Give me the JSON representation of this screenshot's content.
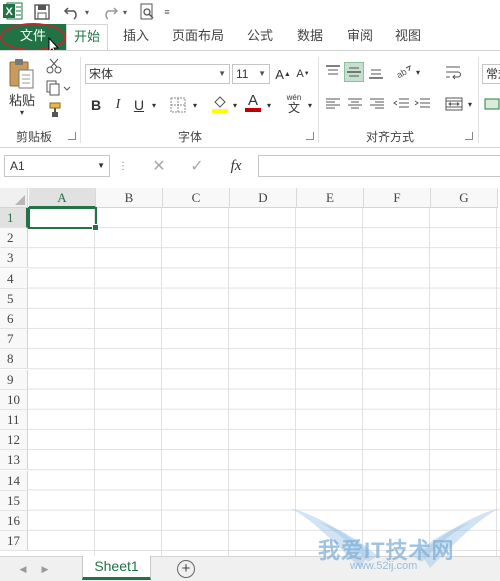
{
  "tabs": [
    "文件",
    "开始",
    "插入",
    "页面布局",
    "公式",
    "数据",
    "审阅",
    "视图"
  ],
  "ribbon": {
    "paste_label": "粘贴",
    "clipboard_label": "剪贴板",
    "font_label": "字体",
    "alignment_label": "对齐方式",
    "font_name": "宋体",
    "font_size": "11",
    "number_format": "常规",
    "bold": "B",
    "italic": "I",
    "underline": "U",
    "grow_font": "A",
    "shrink_font": "A",
    "font_color_glyph": "A",
    "phonetic": "wén",
    "number_format_partial": "常规",
    "accent_color": "#217346",
    "font_color": "#c00000",
    "fill_color": "#ffff00"
  },
  "formula_bar": {
    "name_box": "A1",
    "fx_label": "fx",
    "formula": ""
  },
  "grid": {
    "columns": [
      "A",
      "B",
      "C",
      "D",
      "E",
      "F",
      "G"
    ],
    "rows": [
      "1",
      "2",
      "3",
      "4",
      "5",
      "6",
      "7",
      "8",
      "9",
      "10",
      "11",
      "12",
      "13",
      "14",
      "15",
      "16",
      "17"
    ],
    "active_cell": "A1"
  },
  "sheets": [
    "Sheet1"
  ],
  "add_sheet_glyph": "+",
  "watermark": {
    "text": "我爱IT技术网",
    "url": "www.52ij.com"
  }
}
